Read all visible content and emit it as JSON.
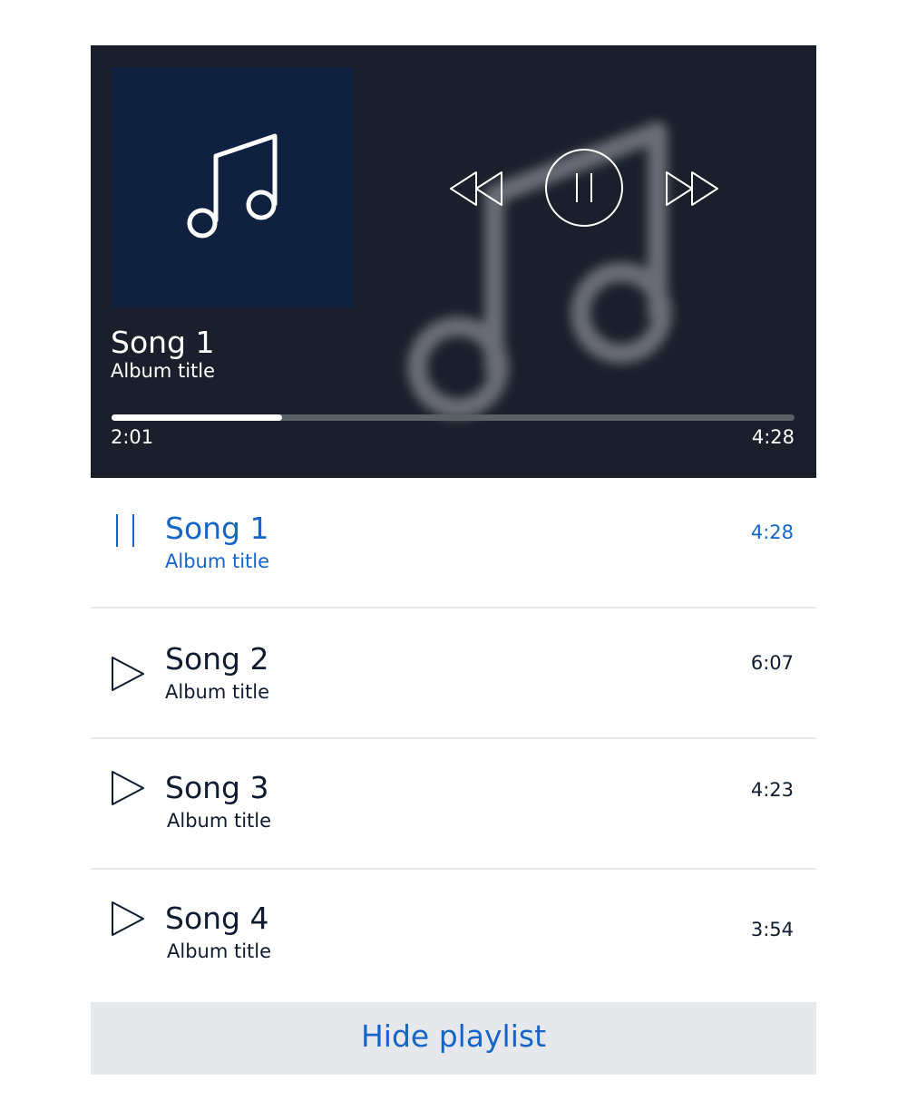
{
  "now_playing": {
    "title": "Song 1",
    "album": "Album title",
    "elapsed": "2:01",
    "total": "4:28",
    "progress_fraction": 0.25
  },
  "controls": {
    "rewind_icon": "rewind-icon",
    "pause_icon": "pause-icon",
    "forward_icon": "fast-forward-icon"
  },
  "playlist": [
    {
      "title": "Song 1",
      "album": "Album title",
      "duration": "4:28",
      "state": "playing",
      "icon": "pause-icon"
    },
    {
      "title": "Song 2",
      "album": "Album title",
      "duration": "6:07",
      "state": "idle",
      "icon": "play-icon"
    },
    {
      "title": "Song 3",
      "album": "Album title",
      "duration": "4:23",
      "state": "idle",
      "icon": "play-icon"
    },
    {
      "title": "Song 4",
      "album": "Album title",
      "duration": "3:54",
      "state": "idle",
      "icon": "play-icon"
    }
  ],
  "hide_playlist_label": "Hide playlist",
  "colors": {
    "player_bg": "#1a1f2b",
    "album_art_bg": "#10203f",
    "accent": "#1565c8",
    "text_dark": "#0f1b2e",
    "button_bg": "#e7e8eb"
  }
}
